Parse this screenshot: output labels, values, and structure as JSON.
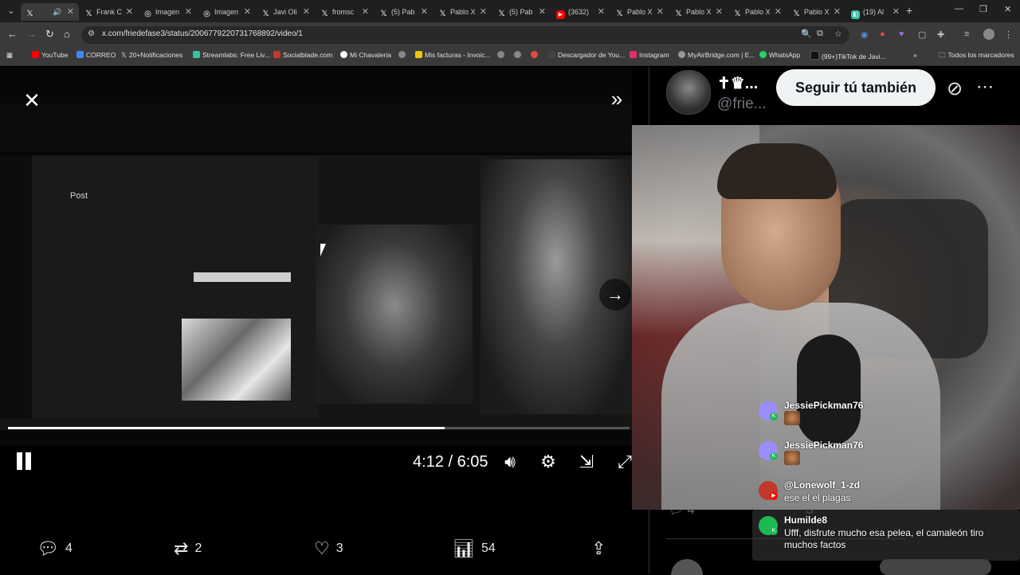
{
  "browser": {
    "tabs": [
      {
        "label": "",
        "icon": "x-logo-icon",
        "active": true
      },
      {
        "label": "Frank C",
        "icon": "x-logo-icon"
      },
      {
        "label": "Imagen",
        "icon": "globe-icon"
      },
      {
        "label": "Imagen",
        "icon": "globe-icon"
      },
      {
        "label": "Javi Oli",
        "icon": "x-logo-icon"
      },
      {
        "label": "fromsc",
        "icon": "x-logo-icon"
      },
      {
        "label": "(5) Pab",
        "icon": "x-logo-icon"
      },
      {
        "label": "Pablo X",
        "icon": "x-logo-icon"
      },
      {
        "label": "(5) Pab",
        "icon": "x-logo-icon"
      },
      {
        "label": "(3632)",
        "icon": "youtube-icon"
      },
      {
        "label": "Pablo X",
        "icon": "x-logo-icon"
      },
      {
        "label": "Pablo X",
        "icon": "x-logo-icon"
      },
      {
        "label": "Pablo X",
        "icon": "x-logo-icon"
      },
      {
        "label": "Pablo X",
        "icon": "x-logo-icon"
      },
      {
        "label": "(19) Al",
        "icon": "streamlabs-icon"
      }
    ],
    "url": "x.com/friedefase3/status/2006779220731768892/video/1",
    "bookmarks": [
      {
        "label": "YouTube",
        "color": "#ff0000"
      },
      {
        "label": "CORREO",
        "color": "#4285f4"
      },
      {
        "label": "20+Notificaciones",
        "color": "#000000"
      },
      {
        "label": "Streamlabs: Free Liv...",
        "color": "#31c3a2"
      },
      {
        "label": "Socialblade.com",
        "color": "#c0392b"
      },
      {
        "label": "Mi Chavaleria",
        "color": "#ffffff"
      },
      {
        "label": "",
        "color": "#888888"
      },
      {
        "label": "Mis facturas - Invoic...",
        "color": "#f1c40f"
      },
      {
        "label": "",
        "color": "#888888"
      },
      {
        "label": "",
        "color": "#888888"
      },
      {
        "label": "",
        "color": "#e74c3c"
      },
      {
        "label": "Descargador de You...",
        "color": "#444444"
      },
      {
        "label": "Instagram",
        "color": "#e1306c"
      },
      {
        "label": "MyAirBridge.com | E...",
        "color": "#999999"
      },
      {
        "label": "WhatsApp",
        "color": "#25d366"
      },
      {
        "label": "(99+)TikTok de Javi...",
        "color": "#111111"
      }
    ],
    "all_bookmarks": "Todos los marcadores"
  },
  "video": {
    "post_label": "Post",
    "time": "4:12 / 6:05",
    "progress": 0.703
  },
  "actions": {
    "replies": "4",
    "reposts": "2",
    "likes": "3",
    "views": "54"
  },
  "profile": {
    "name": "✝♛...",
    "handle": "@frie...",
    "follow_label": "Seguir tú también"
  },
  "background_stats": {
    "replies": "4",
    "reposts": "3"
  },
  "chat": [
    {
      "user": "JessiePickman76",
      "message": "",
      "emote": true,
      "avatar_color": "#9b8cff"
    },
    {
      "user": "JessiePickman76",
      "message": "",
      "emote": true,
      "avatar_color": "#9b8cff"
    },
    {
      "user": "@Lonewolf_1-zd",
      "message": "ese el el plagas",
      "emote": false,
      "avatar_color": "#c0392b"
    },
    {
      "user": "Humilde8",
      "message": "Ufff, disfrute mucho esa pelea, el camaleón tiro muchos factos",
      "emote": false,
      "avatar_color": "#1db954"
    }
  ]
}
